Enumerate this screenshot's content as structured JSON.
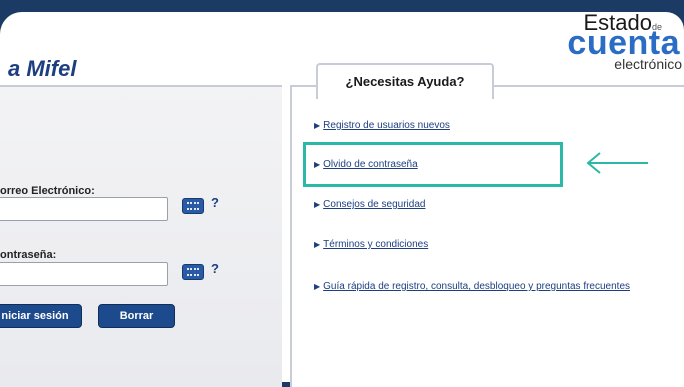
{
  "brand": {
    "title": "a Mifel"
  },
  "logo": {
    "line1": "Estado",
    "line1_small": "de",
    "line2": "cuenta",
    "line3": "electrónico"
  },
  "login": {
    "email_label": "orreo Electrónico:",
    "password_label": "ontraseña:",
    "email_value": "",
    "password_value": "",
    "help_symbol": "?",
    "login_button": "niciar sesión",
    "clear_button": "Borrar"
  },
  "help": {
    "tab_label": "¿Necesitas Ayuda?",
    "links": [
      "Registro de usuarios nuevos",
      "Olvido de contraseña",
      "Consejos de seguridad",
      "Términos y condiciones",
      "Guía rápida de registro, consulta, desbloqueo y preguntas frecuentes"
    ],
    "bullet": "▶"
  },
  "annotation": {
    "highlight_color": "#2bb8a6",
    "arrow_color": "#2bb8a6",
    "arrow_icon": "left-arrow-icon"
  },
  "colors": {
    "brand_blue": "#1d3f80",
    "button_blue": "#1d4a8c",
    "background_navy": "#1b3a64"
  }
}
